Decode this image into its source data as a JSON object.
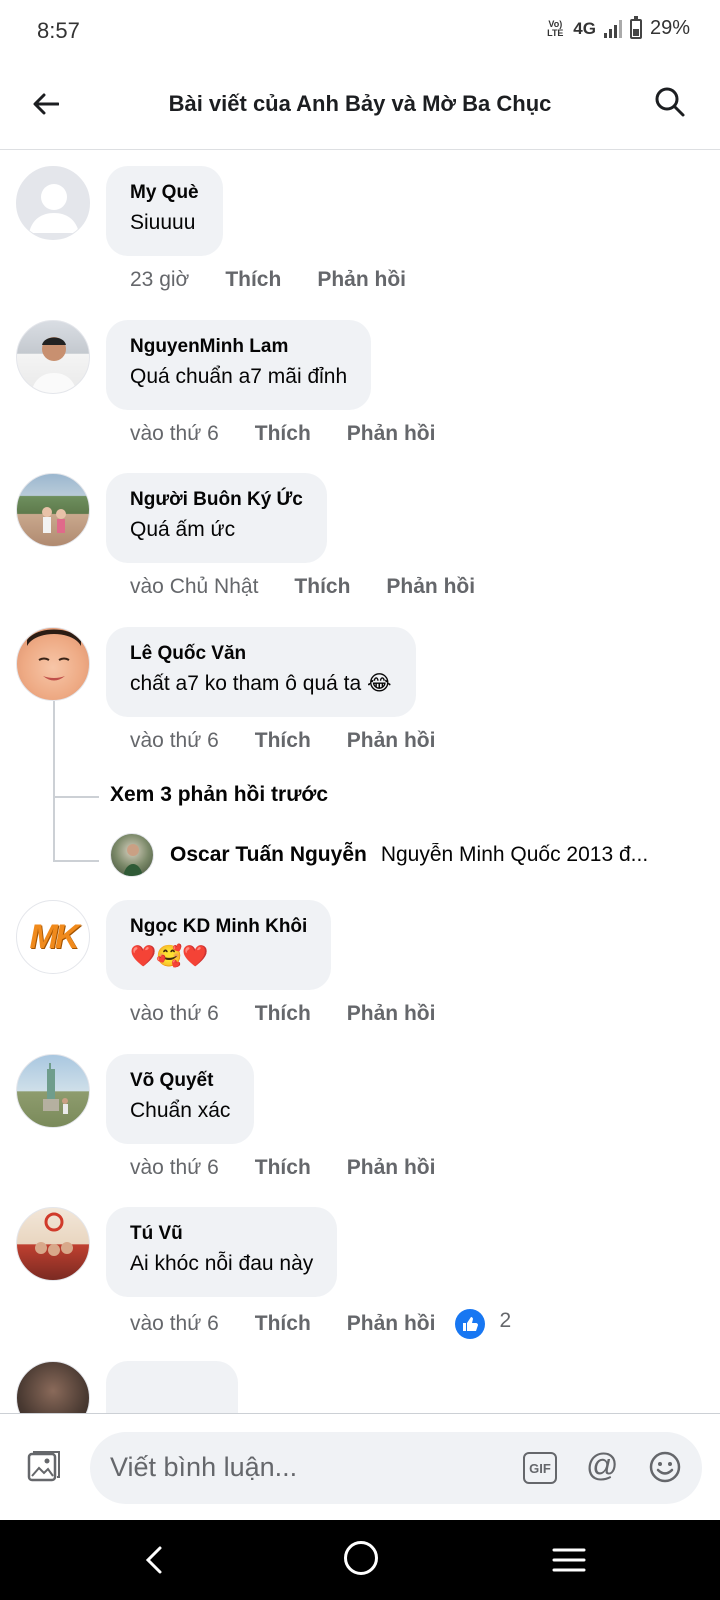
{
  "status_bar": {
    "time": "8:57",
    "volte_label": "Vo) LTE",
    "network": "4G",
    "battery": "29%"
  },
  "header": {
    "title": "Bài viết của Anh Bảy và Mờ Ba Chục"
  },
  "comments": [
    {
      "name": "My Què",
      "text": "Siuuuu",
      "time": "23 giờ",
      "like_label": "Thích",
      "reply_label": "Phản hồi"
    },
    {
      "name": "NguyenMinh Lam",
      "text": "Quá chuẩn a7 mãi đỉnh",
      "time": "vào thứ 6",
      "like_label": "Thích",
      "reply_label": "Phản hồi"
    },
    {
      "name": "Người Buôn Ký Ức",
      "text": "Quá ấm ức",
      "time": "vào Chủ Nhật",
      "like_label": "Thích",
      "reply_label": "Phản hồi"
    },
    {
      "name": "Lê Quốc Văn",
      "text": "chất a7 ko tham ô quá ta 😂",
      "time": "vào thứ 6",
      "like_label": "Thích",
      "reply_label": "Phản hồi"
    },
    {
      "name": "Ngọc KD Minh Khôi",
      "text": "❤️🥰❤️",
      "time": "vào thứ 6",
      "like_label": "Thích",
      "reply_label": "Phản hồi"
    },
    {
      "name": "Võ Quyết",
      "text": "Chuẩn xác",
      "time": "vào thứ 6",
      "like_label": "Thích",
      "reply_label": "Phản hồi"
    },
    {
      "name": "Tú Vũ",
      "text": "Ai khóc nỗi đau này",
      "time": "vào thứ 6",
      "like_label": "Thích",
      "reply_label": "Phản hồi",
      "reaction_count": "2"
    }
  ],
  "thread": {
    "view_previous": "Xem 3 phản hồi trước",
    "reply_name": "Oscar Tuấn Nguyễn",
    "reply_text": "Nguyễn Minh Quốc 2013 đ..."
  },
  "mk_logo_text": "MK",
  "composer": {
    "placeholder": "Viết bình luận...",
    "gif_label": "GIF",
    "mention_label": "@"
  },
  "colors": {
    "bubble": "#f0f2f5",
    "accent": "#1877f2",
    "secondary_text": "#65676b"
  }
}
